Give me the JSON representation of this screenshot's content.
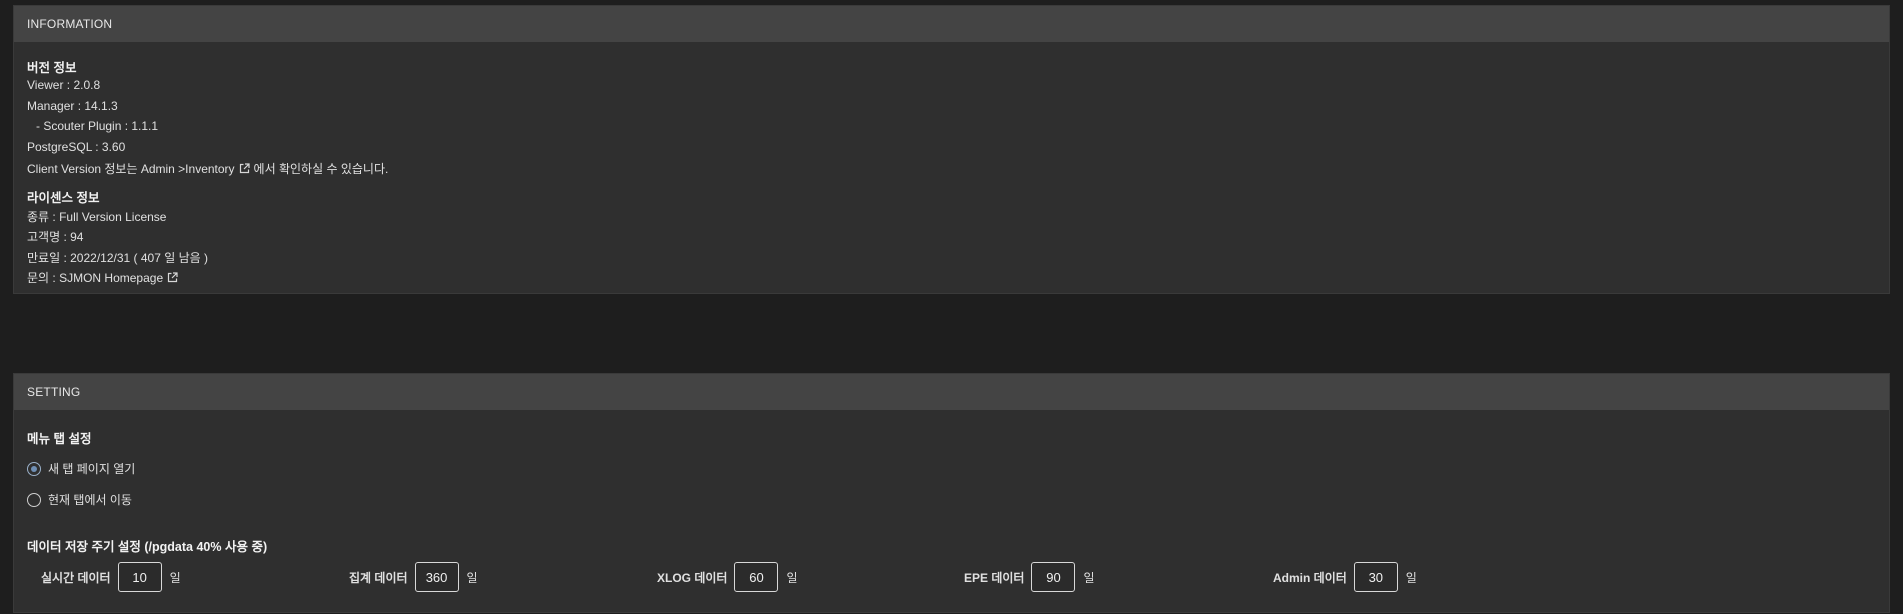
{
  "information": {
    "header": "INFORMATION",
    "version": {
      "title": "버전 정보",
      "viewer": "Viewer : 2.0.8",
      "manager": "Manager : 14.1.3",
      "scouter_plugin": "- Scouter Plugin : 1.1.1",
      "postgresql": "PostgreSQL : 3.60",
      "client_prefix": "Client Version 정보는 Admin >Inventory",
      "client_suffix": "에서 확인하실 수 있습니다."
    },
    "license": {
      "title": "라이센스 정보",
      "type": "종류 : Full Version License",
      "customer": "고객명 : 94",
      "expiry": "만료일 : 2022/12/31 ( 407 일 남음 )",
      "contact_prefix": "문의 : SJMON Homepage"
    }
  },
  "setting": {
    "header": "SETTING",
    "menu_tab": {
      "title": "메뉴 탭 설정",
      "options": [
        {
          "label": "새 탭 페이지 열기",
          "checked": true
        },
        {
          "label": "현재 탭에서 이동",
          "checked": false
        }
      ]
    },
    "storage": {
      "title": "데이터 저장 주기 설정 (/pgdata 40% 사용 중)",
      "unit": "일",
      "items": [
        {
          "label": "실시간 데이터",
          "value": "10"
        },
        {
          "label": "집계 데이터",
          "value": "360"
        },
        {
          "label": "XLOG 데이터",
          "value": "60"
        },
        {
          "label": "EPE 데이터",
          "value": "90"
        },
        {
          "label": "Admin 데이터",
          "value": "30"
        }
      ]
    }
  },
  "icons": {
    "external_link": "external-link-icon"
  },
  "colors": {
    "background": "#1e1e1e",
    "panel": "#2f2f2f",
    "panel_header": "#444444",
    "radio_accent": "#6f8fb5"
  }
}
